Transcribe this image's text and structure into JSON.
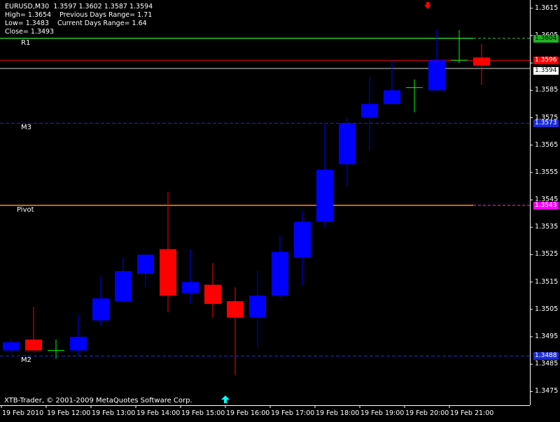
{
  "header": {
    "symbol_line": "EURUSD,M30  1.3597 1.3602 1.3587 1.3594",
    "high_line": "High= 1.3654    Previous Days Range= 1.71",
    "low_line": "Low= 1.3483    Current Days Range= 1.64",
    "close_line": "Close= 1.3493"
  },
  "footer": {
    "copyright": "XTB-Trader, © 2001-2009 MetaQuotes Software Corp."
  },
  "colors": {
    "background": "#000000",
    "bull": "#0000ff",
    "bear": "#ff0000",
    "doji": "#00ff00",
    "pivot": "#ff8c1a",
    "r1": "#35c435",
    "mid": "#1a2bd8",
    "bid": "#ff0000",
    "ask": "#ffffff",
    "arrow_down": "#ff0000",
    "arrow_up": "#00ffff"
  },
  "chart_data": {
    "type": "candlestick",
    "ylim": [
      1.347,
      1.3618
    ],
    "price_ticks": [
      "1.3615",
      "1.3605",
      "1.3595",
      "1.3585",
      "1.3575",
      "1.3565",
      "1.3555",
      "1.3545",
      "1.3535",
      "1.3525",
      "1.3515",
      "1.3505",
      "1.3495",
      "1.3485",
      "1.3475"
    ],
    "time_labels": [
      "19 Feb 2010",
      "19 Feb 12:00",
      "19 Feb 13:00",
      "19 Feb 14:00",
      "19 Feb 15:00",
      "19 Feb 16:00",
      "19 Feb 17:00",
      "19 Feb 18:00",
      "19 Feb 19:00",
      "19 Feb 20:00",
      "19 Feb 21:00"
    ],
    "levels": [
      {
        "name": "R1",
        "value": 1.3604,
        "label": "1.3604",
        "style": "r1"
      },
      {
        "name": "M3",
        "value": 1.3573,
        "label": "1.3573",
        "style": "mid"
      },
      {
        "name": "Pivot",
        "value": 1.3543,
        "label": "1.3543",
        "style": "pivot"
      },
      {
        "name": "M2",
        "value": 1.3488,
        "label": "1.3488",
        "style": "mid"
      }
    ],
    "bid": {
      "value": 1.3596,
      "label": "1.3596"
    },
    "ask": {
      "value": 1.3594,
      "label": "1.3594"
    },
    "candles": [
      {
        "t": "19 Feb 2010 10:30",
        "o": 1.349,
        "h": 1.3494,
        "l": 1.3489,
        "c": 1.3493
      },
      {
        "t": "19 Feb 11:00",
        "o": 1.3494,
        "h": 1.3506,
        "l": 1.3491,
        "c": 1.349
      },
      {
        "t": "19 Feb 11:30",
        "o": 1.349,
        "h": 1.3494,
        "l": 1.3487,
        "c": 1.349
      },
      {
        "t": "19 Feb 12:00",
        "o": 1.349,
        "h": 1.3503,
        "l": 1.3488,
        "c": 1.3495
      },
      {
        "t": "19 Feb 12:30",
        "o": 1.3501,
        "h": 1.3517,
        "l": 1.3499,
        "c": 1.3509
      },
      {
        "t": "19 Feb 13:00",
        "o": 1.3508,
        "h": 1.3524,
        "l": 1.3508,
        "c": 1.3519
      },
      {
        "t": "19 Feb 13:30",
        "o": 1.3518,
        "h": 1.3525,
        "l": 1.3513,
        "c": 1.3525
      },
      {
        "t": "19 Feb 14:00",
        "o": 1.3527,
        "h": 1.3548,
        "l": 1.3504,
        "c": 1.351
      },
      {
        "t": "19 Feb 14:30",
        "o": 1.3511,
        "h": 1.3527,
        "l": 1.3507,
        "c": 1.3515
      },
      {
        "t": "19 Feb 15:00",
        "o": 1.3514,
        "h": 1.3522,
        "l": 1.3502,
        "c": 1.3507
      },
      {
        "t": "19 Feb 15:30",
        "o": 1.3508,
        "h": 1.3513,
        "l": 1.3481,
        "c": 1.3502
      },
      {
        "t": "19 Feb 16:00",
        "o": 1.3502,
        "h": 1.3519,
        "l": 1.3491,
        "c": 1.351
      },
      {
        "t": "19 Feb 16:30",
        "o": 1.351,
        "h": 1.3532,
        "l": 1.3509,
        "c": 1.3526
      },
      {
        "t": "19 Feb 17:00",
        "o": 1.3524,
        "h": 1.3541,
        "l": 1.3514,
        "c": 1.3537
      },
      {
        "t": "19 Feb 17:30",
        "o": 1.3537,
        "h": 1.3573,
        "l": 1.3535,
        "c": 1.3556
      },
      {
        "t": "19 Feb 18:00",
        "o": 1.3558,
        "h": 1.3575,
        "l": 1.355,
        "c": 1.3573
      },
      {
        "t": "19 Feb 18:30",
        "o": 1.3575,
        "h": 1.359,
        "l": 1.3563,
        "c": 1.358
      },
      {
        "t": "19 Feb 19:00",
        "o": 1.358,
        "h": 1.3596,
        "l": 1.358,
        "c": 1.3585
      },
      {
        "t": "19 Feb 19:30",
        "o": 1.3586,
        "h": 1.3589,
        "l": 1.3577,
        "c": 1.3586
      },
      {
        "t": "19 Feb 20:00",
        "o": 1.3585,
        "h": 1.3607,
        "l": 1.3585,
        "c": 1.3596
      },
      {
        "t": "19 Feb 20:30",
        "o": 1.3595,
        "h": 1.3607,
        "l": 1.3595,
        "c": 1.3596
      },
      {
        "t": "19 Feb 21:00",
        "o": 1.3597,
        "h": 1.3602,
        "l": 1.3587,
        "c": 1.3594
      }
    ]
  }
}
